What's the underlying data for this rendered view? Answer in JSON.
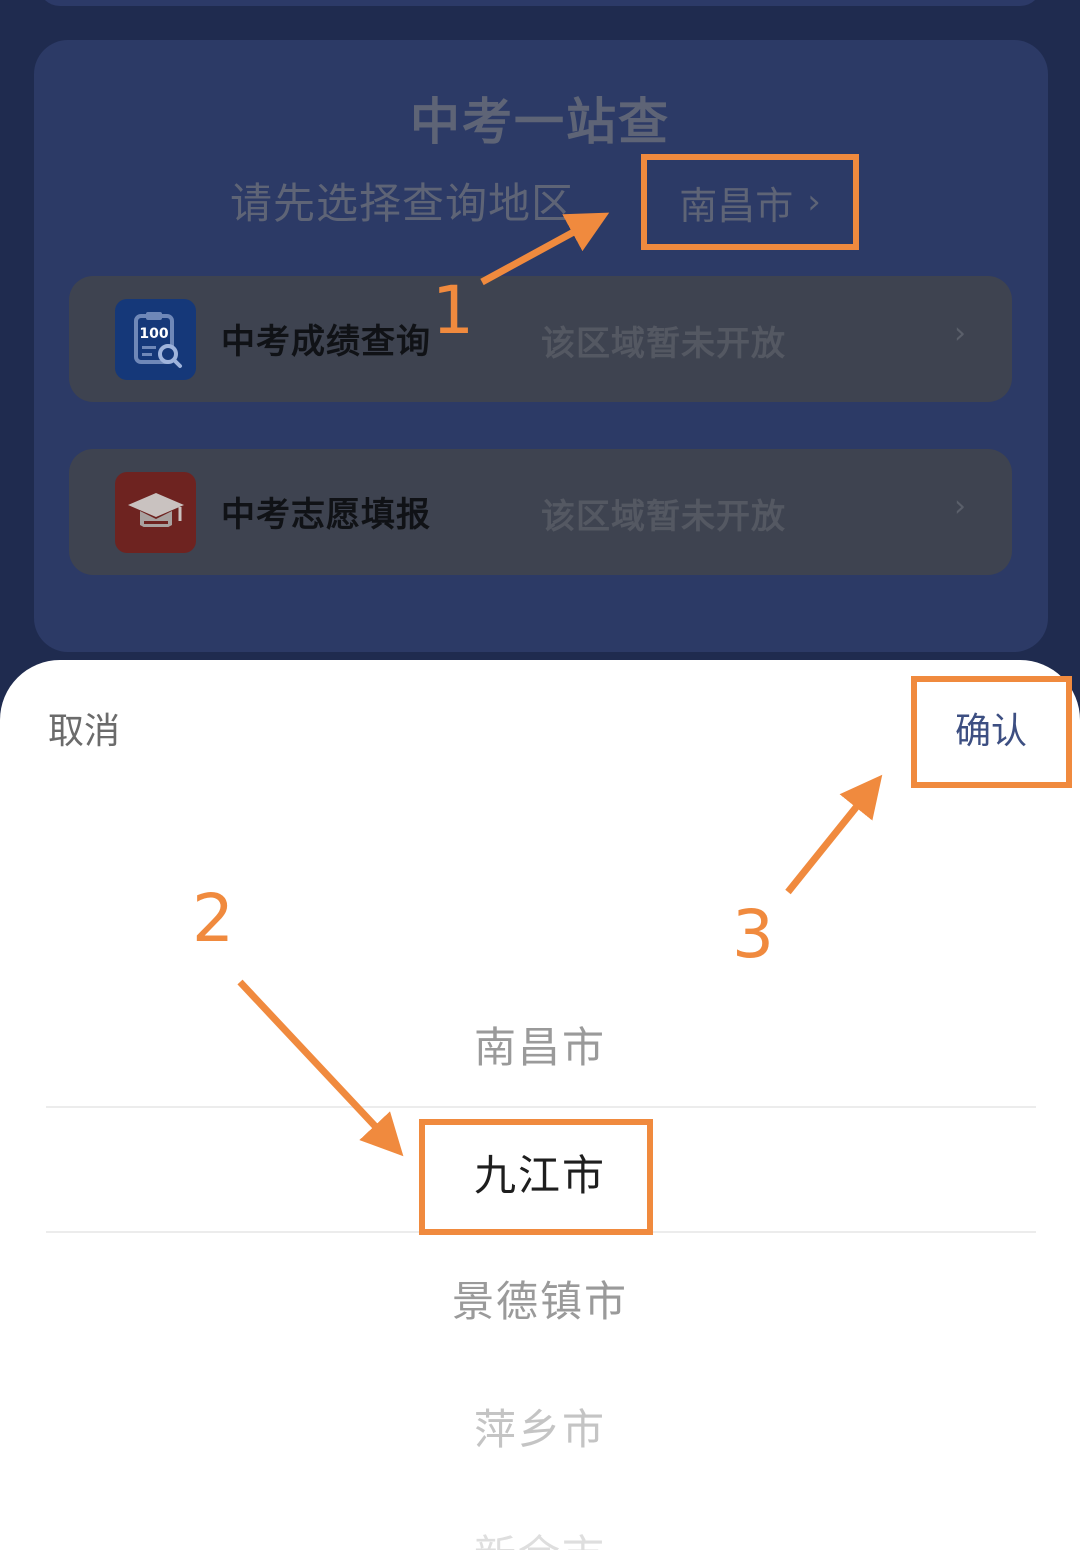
{
  "card": {
    "title": "中考一站查",
    "region_prompt": "请先选择查询地区",
    "region_value": "南昌市",
    "items": [
      {
        "label": "中考成绩查询",
        "status": "该区域暂未开放",
        "icon": "score-report-icon"
      },
      {
        "label": "中考志愿填报",
        "status": "该区域暂未开放",
        "icon": "graduation-cap-icon"
      }
    ]
  },
  "picker": {
    "cancel": "取消",
    "confirm": "确认",
    "options": [
      "南昌市",
      "九江市",
      "景德镇市",
      "萍乡市",
      "新余市"
    ],
    "selected": "九江市"
  },
  "annotations": {
    "step1": "1",
    "step2": "2",
    "step3": "3"
  },
  "colors": {
    "annotation": "#f08a3e",
    "confirm": "#3d4f82",
    "background": "#1f2b4f"
  }
}
